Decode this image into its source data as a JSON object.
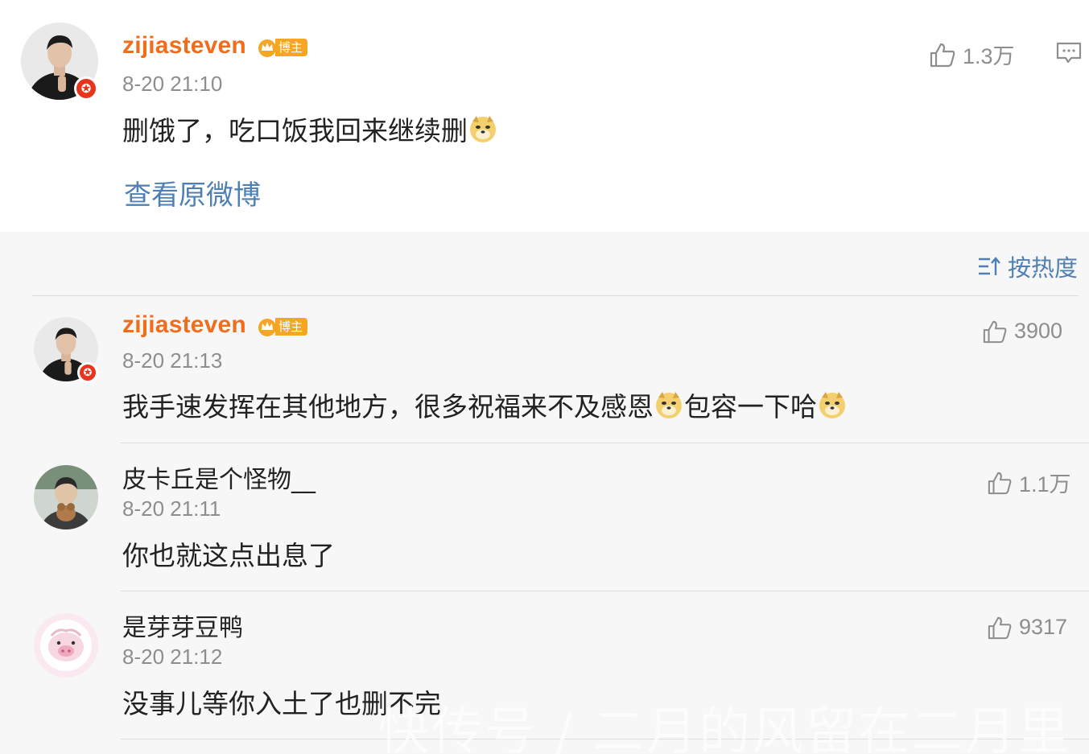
{
  "post": {
    "author": "zijiasteven",
    "badge": "博主",
    "time": "8-20 21:10",
    "text": "删饿了，吃口饭我回来继续删",
    "view_original": "查看原微博",
    "likes": "1.3万"
  },
  "sort": {
    "label": "按热度"
  },
  "comments": [
    {
      "author": "zijiasteven",
      "badge": "博主",
      "time": "8-20 21:13",
      "text_part1": "我手速发挥在其他地方，很多祝福来不及感恩",
      "text_part2": "包容一下哈",
      "likes": "3900"
    },
    {
      "author": "皮卡丘是个怪物__",
      "time": "8-20 21:11",
      "text": "你也就这点出息了",
      "likes": "1.1万"
    },
    {
      "author": "是芽芽豆鸭",
      "time": "8-20 21:12",
      "text": "没事儿等你入土了也删不完",
      "likes": "9317"
    }
  ],
  "watermark": "快传号 / 二月的风留在二月里",
  "colors": {
    "author_orange": "#f26d1b",
    "link_blue": "#4f80b5",
    "verified_red": "#e8341c",
    "badge_gold": "#f5a623"
  },
  "icons": [
    "thumbs-up-icon",
    "comment-icon",
    "sort-icon",
    "doge-emoji",
    "crown-icon",
    "verified-star-icon"
  ]
}
